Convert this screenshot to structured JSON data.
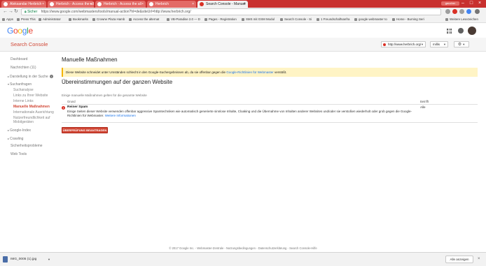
{
  "browser": {
    "tabs": [
      {
        "label": "Aleksandar Herbrich",
        "active": false
      },
      {
        "label": "Herbrich - Access the all",
        "active": false
      },
      {
        "label": "Herbrich - Access the all",
        "active": false
      },
      {
        "label": "Herbrich",
        "active": false
      },
      {
        "label": "Search Console - Manuel",
        "active": true
      }
    ],
    "profile_label": "gaucher",
    "address": {
      "secure_label": "Sicher",
      "url": "https://www.google.com/webmasters/tools/manual-action?hl=de&siteUrl=http://www.herbrich.org/"
    },
    "bookmarks": [
      "Apps",
      "Press This",
      "Administrator",
      "Bookmarks",
      "Crowne Plaza Hamb",
      "Access the alternat",
      "VB-Paradise 2.0 — D",
      "Pages - Registration",
      "SMS mit GSM Modul",
      "Search Console - Si",
      "1 Freundschaftsanfra",
      "google webmaster to",
      "Home - Burning Seri",
      "Weitere Lesezeichen"
    ]
  },
  "google_bar": {
    "logo": [
      "G",
      "o",
      "o",
      "g",
      "l",
      "e"
    ]
  },
  "header": {
    "product": "Search Console",
    "site_selector": "http://www.herbrich.org/",
    "user_selector": "millis",
    "settings_icon": "gear-icon"
  },
  "sidebar": {
    "dashboard": "Dashboard",
    "messages": "Nachrichten (11)",
    "search_appearance": "Darstellung in der Suche",
    "search_traffic": "Suchanfragen",
    "search_analytics": "Suchanalyse",
    "links_to_site": "Links zu Ihrer Website",
    "internal_links": "Interne Links",
    "manual_actions": "Manuelle Maßnahmen",
    "intl_targeting": "Internationale Ausrichtung",
    "mobile_usability_1": "Nutzerfreundlichkeit auf",
    "mobile_usability_2": "Mobilgeräten",
    "google_index": "Google-Index",
    "crawling": "Crawling",
    "security": "Sicherheitsprobleme",
    "web_tools": "Web Tools"
  },
  "main": {
    "title": "Manuelle Maßnahmen",
    "warning": {
      "text": "Diese Website schneidet unter Umständen schlecht in den Google-Suchergebnissen ab, da sie offenbar gegen die",
      "link": "Google-Richtlinien für Webmaster",
      "suffix": "verstößt."
    },
    "section_title": "Übereinstimmungen auf der ganzen Website",
    "section_subtitle": "Einige manuelle Maßnahmen gelten für die gesamte Website",
    "table": {
      "col_reason": "Grund",
      "col_affected": "Betrifft",
      "row": {
        "title": "Reiner Spam",
        "description": "Einige Seiten dieser Website verwenden offenbar aggressive Spamtechniken wie automatisch generierte sinnlose Inhalte, Cloaking und die Übernahme von Inhalten anderer Websites und/oder sie verstoßen wiederholt oder grob gegen die Google-Richtlinien für Webmaster.",
        "more_link": "Weitere Informationen",
        "affected": "Alle"
      }
    },
    "review_button": "ÜBERPRÜFUNG BEANTRAGEN"
  },
  "footer": "© 2017 Google Inc. - Webmaster-Zentrale - Nutzungsbedingungen - Datenschutzerklärung - Search Console-Hilfe",
  "download_bar": {
    "file_name": "IMG_0005 (1).jpg",
    "show_all": "Alle anzeigen"
  },
  "colors": {
    "tabbar": "#c8302e",
    "accent": "#d14836",
    "warning_bg": "#fff4c5",
    "link": "#1a73e8"
  }
}
